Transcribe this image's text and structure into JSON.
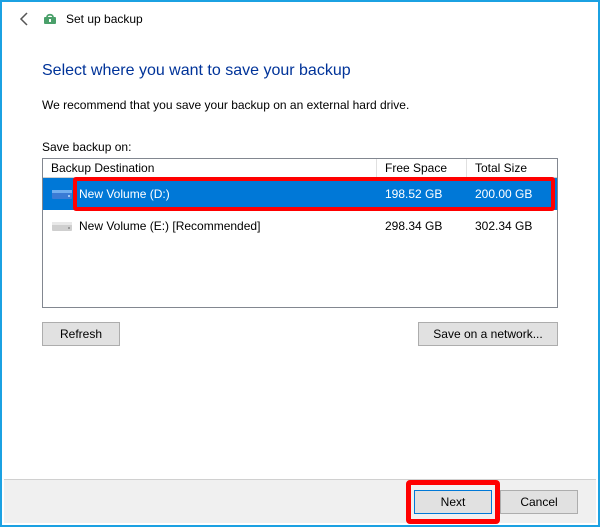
{
  "titlebar": {
    "title": "Set up backup"
  },
  "heading": "Select where you want to save your backup",
  "subtext": "We recommend that you save your backup on an external hard drive.",
  "list_label": "Save backup on:",
  "columns": {
    "dest": "Backup Destination",
    "free": "Free Space",
    "total": "Total Size"
  },
  "rows": [
    {
      "name": "New Volume (D:)",
      "free": "198.52 GB",
      "total": "200.00 GB",
      "selected": true
    },
    {
      "name": "New Volume (E:) [Recommended]",
      "free": "298.34 GB",
      "total": "302.34 GB",
      "selected": false
    }
  ],
  "buttons": {
    "refresh": "Refresh",
    "network": "Save on a network...",
    "next": "Next",
    "cancel": "Cancel"
  }
}
